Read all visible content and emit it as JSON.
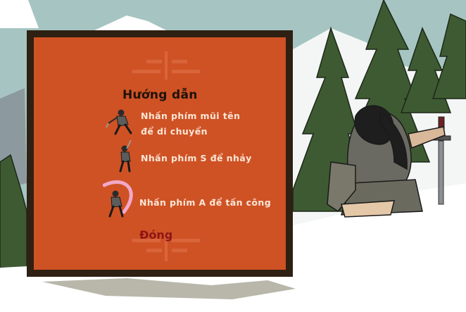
{
  "dialog": {
    "title": "Hướng dẫn",
    "instructions": [
      {
        "icon": "ninja-run-icon",
        "lines": [
          "Nhấn phím mũi tên",
          "để di chuyển"
        ]
      },
      {
        "icon": "ninja-jump-icon",
        "lines": [
          "Nhấn phím S để nhảy"
        ]
      },
      {
        "icon": "ninja-attack-icon",
        "lines": [
          "Nhấn phím A để tấn công"
        ]
      }
    ],
    "close_label": "Đóng"
  },
  "colors": {
    "panel": "#cf5225",
    "frame": "#2e2012",
    "title": "#1e1208",
    "text": "#fbe7d6",
    "close": "#8e1515",
    "sky": "#a6c5c2",
    "snow": "#ffffff",
    "forest": "#3e5a32"
  }
}
